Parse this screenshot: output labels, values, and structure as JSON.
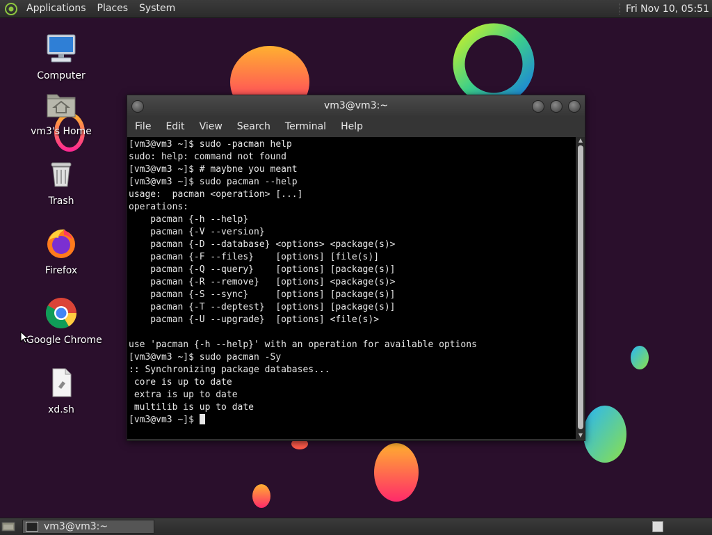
{
  "top_panel": {
    "menus": [
      "Applications",
      "Places",
      "System"
    ],
    "clock": "Fri Nov 10, 05:51"
  },
  "desktop_icons": [
    {
      "label": "Computer",
      "icon": "computer-icon"
    },
    {
      "label": "vm3's Home",
      "icon": "home-folder-icon"
    },
    {
      "label": "Trash",
      "icon": "trash-icon"
    },
    {
      "label": "Firefox",
      "icon": "firefox-icon"
    },
    {
      "label": "Google Chrome",
      "icon": "chrome-icon"
    },
    {
      "label": "xd.sh",
      "icon": "script-file-icon"
    }
  ],
  "terminal": {
    "title": "vm3@vm3:~",
    "menu": [
      "File",
      "Edit",
      "View",
      "Search",
      "Terminal",
      "Help"
    ],
    "lines": [
      "[vm3@vm3 ~]$ sudo -pacman help",
      "sudo: help: command not found",
      "[vm3@vm3 ~]$ # maybne you meant",
      "[vm3@vm3 ~]$ sudo pacman --help",
      "usage:  pacman <operation> [...]",
      "operations:",
      "    pacman {-h --help}",
      "    pacman {-V --version}",
      "    pacman {-D --database} <options> <package(s)>",
      "    pacman {-F --files}    [options] [file(s)]",
      "    pacman {-Q --query}    [options] [package(s)]",
      "    pacman {-R --remove}   [options] <package(s)>",
      "    pacman {-S --sync}     [options] [package(s)]",
      "    pacman {-T --deptest}  [options] [package(s)]",
      "    pacman {-U --upgrade}  [options] <file(s)>",
      "",
      "use 'pacman {-h --help}' with an operation for available options",
      "[vm3@vm3 ~]$ sudo pacman -Sy",
      ":: Synchronizing package databases...",
      " core is up to date",
      " extra is up to date",
      " multilib is up to date"
    ],
    "prompt": "[vm3@vm3 ~]$ "
  },
  "taskbar": {
    "window_button": "vm3@vm3:~"
  },
  "colors": {
    "wallpaper": "#2a0f2c",
    "terminal_bg": "#000000",
    "terminal_fg": "#e6e6e6",
    "panel": "#2f2f2f"
  }
}
